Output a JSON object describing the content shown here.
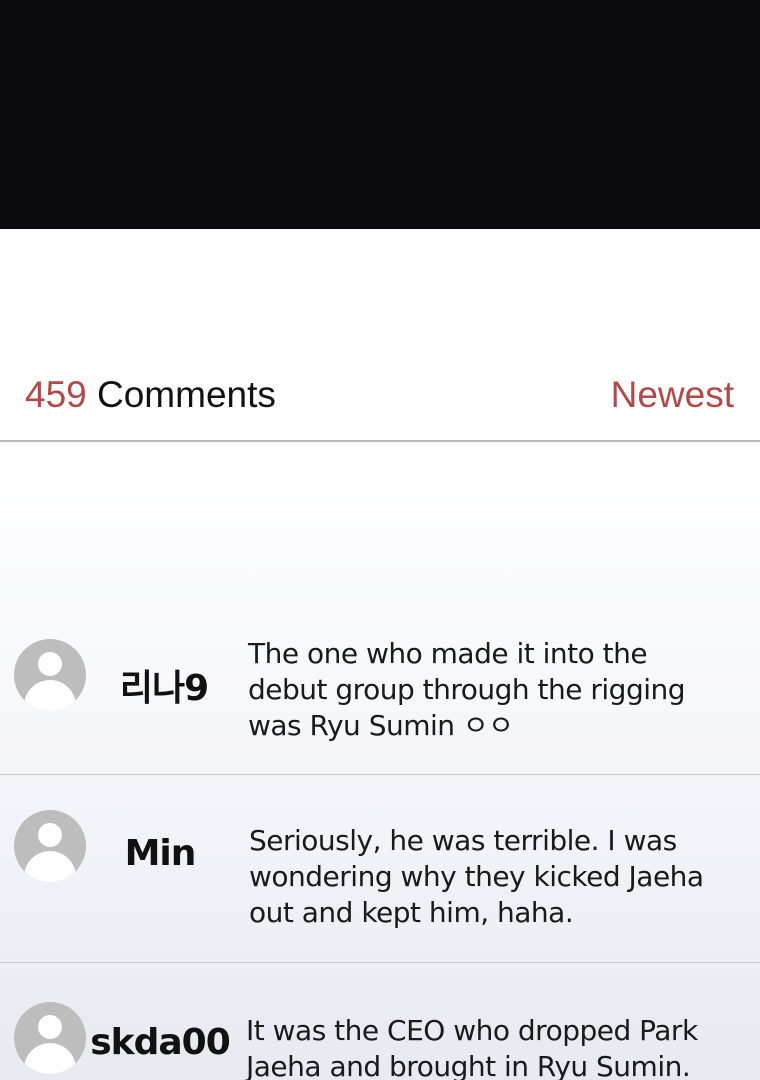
{
  "header": {
    "count": "459",
    "label": " Comments",
    "sort_label": "Newest"
  },
  "comments": [
    {
      "username": "리나9",
      "line1": "The one who made it into the",
      "line2": "debut group through the rigging",
      "line3": "was Ryu Sumin ㅇㅇ"
    },
    {
      "username": "Min",
      "line1": "Seriously, he was terrible. I was",
      "line2": "wondering why they kicked Jaeha",
      "line3": "out and kept him, haha."
    },
    {
      "username": "skda00",
      "line1": "It was the CEO who dropped Park",
      "line2": "Jaeha and brought in Ryu Sumin."
    }
  ],
  "colors": {
    "accent": "#b04a4a",
    "top_panel": "#0b0b0f",
    "divider": "#b9b9b9",
    "avatar": "#bdbdbd"
  },
  "icons": {
    "avatar": "default-user-avatar-icon"
  }
}
